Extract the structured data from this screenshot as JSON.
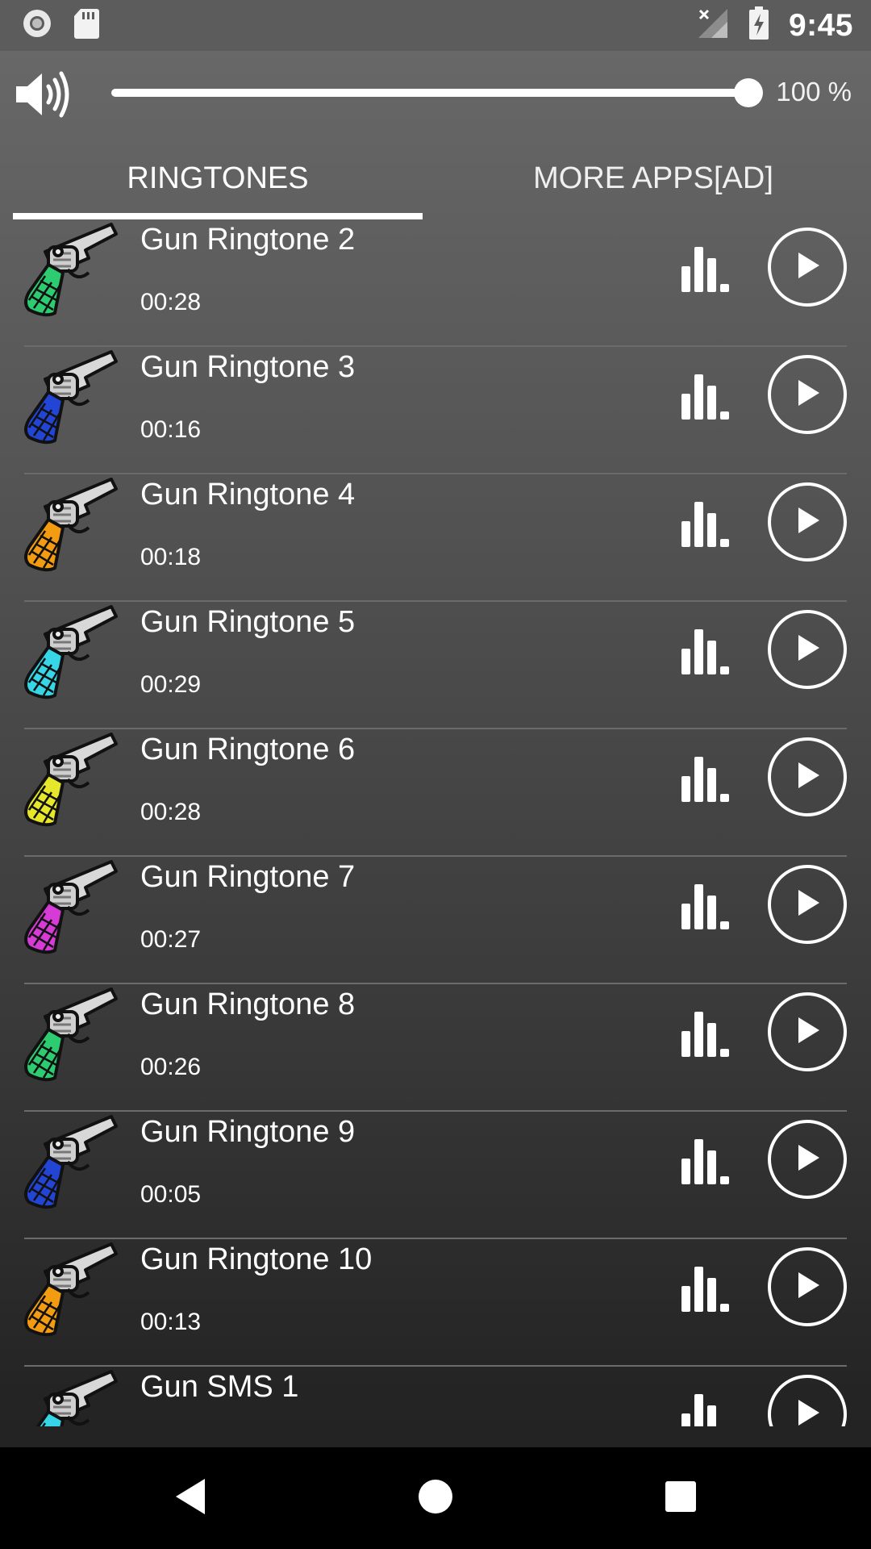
{
  "status_bar": {
    "time": "9:45",
    "icons": [
      "record-icon",
      "sd-card-icon",
      "no-signal-icon",
      "battery-charging-icon"
    ]
  },
  "volume": {
    "icon": "speaker-icon",
    "level": 1.0,
    "percent_label": "100 %"
  },
  "tabs": [
    {
      "label": "RINGTONES",
      "selected": true
    },
    {
      "label": "MORE APPS[AD]",
      "selected": false
    }
  ],
  "ringtones": [
    {
      "title": "Gun Ringtone 2",
      "duration": "00:28",
      "grip_color": "#2ecc71"
    },
    {
      "title": "Gun Ringtone 3",
      "duration": "00:16",
      "grip_color": "#2245d6"
    },
    {
      "title": "Gun Ringtone 4",
      "duration": "00:18",
      "grip_color": "#f39c12"
    },
    {
      "title": "Gun Ringtone 5",
      "duration": "00:29",
      "grip_color": "#36d6e7"
    },
    {
      "title": "Gun Ringtone 6",
      "duration": "00:28",
      "grip_color": "#e6e62a"
    },
    {
      "title": "Gun Ringtone 7",
      "duration": "00:27",
      "grip_color": "#d63bd6"
    },
    {
      "title": "Gun Ringtone 8",
      "duration": "00:26",
      "grip_color": "#2ecc71"
    },
    {
      "title": "Gun Ringtone 9",
      "duration": "00:05",
      "grip_color": "#2245d6"
    },
    {
      "title": "Gun Ringtone 10",
      "duration": "00:13",
      "grip_color": "#f39c12"
    },
    {
      "title": "Gun SMS 1",
      "duration": "",
      "grip_color": "#36d6e7"
    }
  ],
  "nav": [
    "back-icon",
    "home-icon",
    "recents-icon"
  ]
}
